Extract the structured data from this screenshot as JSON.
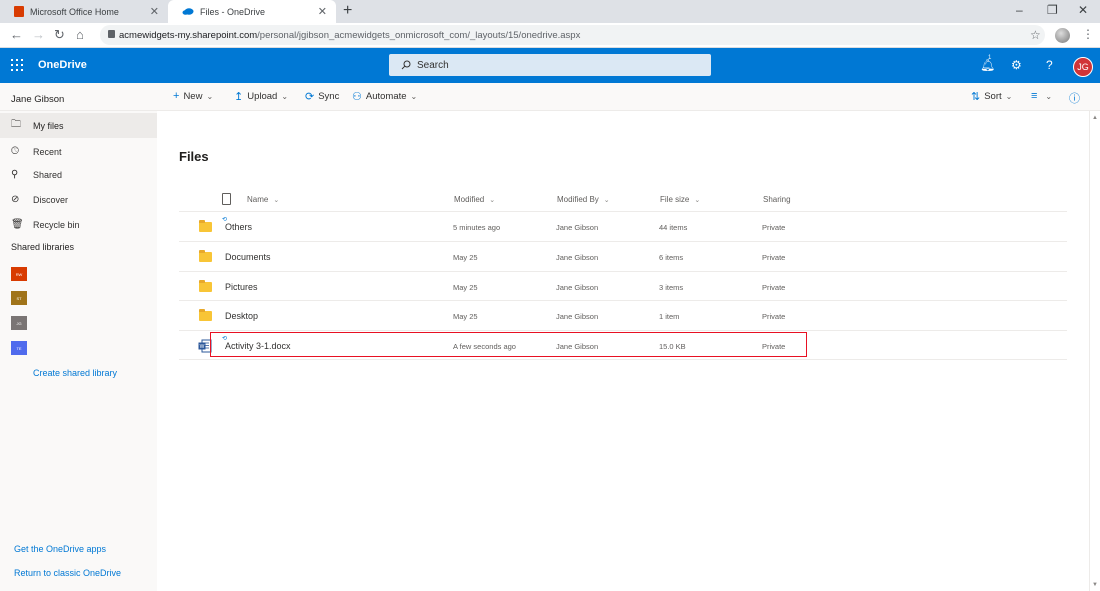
{
  "browser": {
    "tabs": [
      {
        "title": "Microsoft Office Home",
        "icon": "office-icon",
        "color": "#d83b01"
      },
      {
        "title": "Files - OneDrive",
        "icon": "onedrive-cloud-icon",
        "color": "#0078d4"
      }
    ],
    "new_tab": "+",
    "window_controls": {
      "minimize": "–",
      "restore": "❐",
      "close": "✕"
    },
    "url_host": "acmewidgets-my.sharepoint.com",
    "url_path": "/personal/jgibson_acmewidgets_onmicrosoft_com/_layouts/15/onedrive.aspx"
  },
  "suite": {
    "app_name": "OneDrive",
    "search_placeholder": "Search",
    "notification_count": "1",
    "user_initials": "JG",
    "accent_color": "#0078d4"
  },
  "commandbar": {
    "user_name": "Jane Gibson",
    "new": "New",
    "upload": "Upload",
    "sync": "Sync",
    "automate": "Automate",
    "sort": "Sort"
  },
  "nav": {
    "items": [
      {
        "label": "My files",
        "icon": "folder-icon",
        "selected": true
      },
      {
        "label": "Recent",
        "icon": "clock-icon"
      },
      {
        "label": "Shared",
        "icon": "people-icon"
      },
      {
        "label": "Discover",
        "icon": "compass-icon"
      },
      {
        "label": "Recycle bin",
        "icon": "trash-icon"
      }
    ],
    "shared_libraries_heading": "Shared libraries",
    "libraries": [
      {
        "abbr": "RW",
        "color": "#d83b01"
      },
      {
        "abbr": "ST",
        "color": "#a0741a"
      },
      {
        "abbr": "JG",
        "color": "#7a7574"
      },
      {
        "abbr": "TE",
        "color": "#4f6bed"
      }
    ],
    "create_library": "Create shared library",
    "get_apps": "Get the OneDrive apps",
    "classic": "Return to classic OneDrive"
  },
  "main": {
    "title": "Files",
    "columns": {
      "name": "Name",
      "modified": "Modified",
      "modified_by": "Modified By",
      "file_size": "File size",
      "sharing": "Sharing"
    },
    "rows": [
      {
        "name": "Others",
        "type": "folder",
        "modified": "5 minutes ago",
        "modified_by": "Jane Gibson",
        "size": "44 items",
        "sharing": "Private"
      },
      {
        "name": "Documents",
        "type": "folder",
        "modified": "May 25",
        "modified_by": "Jane Gibson",
        "size": "6 items",
        "sharing": "Private"
      },
      {
        "name": "Pictures",
        "type": "folder",
        "modified": "May 25",
        "modified_by": "Jane Gibson",
        "size": "3 items",
        "sharing": "Private"
      },
      {
        "name": "Desktop",
        "type": "folder",
        "modified": "May 25",
        "modified_by": "Jane Gibson",
        "size": "1 item",
        "sharing": "Private"
      },
      {
        "name": "Activity 3-1.docx",
        "type": "word",
        "modified": "A few seconds ago",
        "modified_by": "Jane Gibson",
        "size": "15.0 KB",
        "sharing": "Private"
      }
    ]
  }
}
